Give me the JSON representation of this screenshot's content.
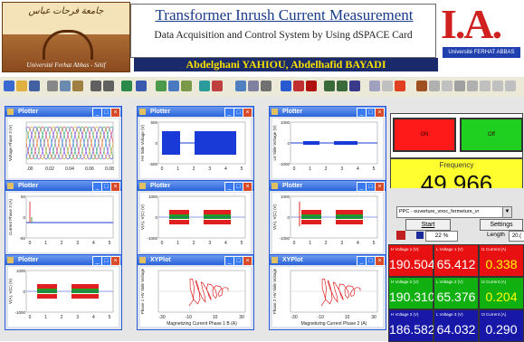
{
  "header": {
    "title": "Transformer Inrush Current Measurement",
    "subtitle": "Data Acquisition and Control System by Using dSPACE Card",
    "authors": "Abdelghani YAHIOU, Abdelhafid BAYADI",
    "left_logo_script": "جامعة فرحات عباس",
    "left_logo_text": "Université Ferhat Abbas - Sétif",
    "right_logo_letters": "I.A.",
    "right_logo_band": "Université FERHAT ABBAS"
  },
  "plots": [
    {
      "title": "Plotter",
      "ylabel": "Voltage Phase 3 (V)",
      "yticks": [
        "",
        "",
        ""
      ],
      "xticks": [
        ".00",
        "0.02",
        "0.04",
        "0.06",
        "0.08"
      ]
    },
    {
      "title": "Plotter",
      "ylabel": "HV Side Voltage (V)",
      "yticks": [
        "500",
        "0",
        "-500"
      ],
      "xticks": [
        "0",
        "1",
        "2",
        "3",
        "4",
        "5"
      ]
    },
    {
      "title": "Plotter",
      "ylabel": "LV Side Voltage (V)",
      "yticks": [
        "1000",
        "0",
        "-1000"
      ],
      "xticks": [
        "0",
        "1",
        "2",
        "3",
        "4",
        "5"
      ]
    },
    {
      "title": "Plotter",
      "ylabel": "Current Phase 3 (A)",
      "yticks": [
        "50",
        "0",
        "-50"
      ],
      "xticks": [
        "0",
        "1",
        "2",
        "3",
        "4",
        "5"
      ]
    },
    {
      "title": "Plotter",
      "ylabel": "V(A), V(C) (V)",
      "yticks": [
        "1000",
        "0",
        "-1000"
      ],
      "xticks": [
        "0",
        "1",
        "2",
        "3",
        "4",
        "5"
      ]
    },
    {
      "title": "Plotter",
      "ylabel": "V(A), V(C) (V)",
      "yticks": [
        "1000",
        "0",
        "-1000"
      ],
      "xticks": [
        "0",
        "1",
        "2",
        "3",
        "4",
        "5"
      ]
    },
    {
      "title": "Plotter",
      "ylabel": "V(A), V(C) (V)",
      "yticks": [
        "1000",
        "0",
        "-1000"
      ],
      "xticks": [
        "0",
        "1",
        "2",
        "3",
        "4",
        "5"
      ]
    },
    {
      "title": "XYPlot",
      "ylabel": "Phase 1 HV Side Voltage",
      "xlabel": "Magnetizing Current Phase 1 B (A)",
      "yticks": [
        "",
        ""
      ],
      "xticks": [
        "-30",
        "-10",
        "10",
        "30"
      ]
    },
    {
      "title": "XYPlot",
      "ylabel": "Phase 2 HV Side Voltage",
      "xlabel": "Magnetizing Current Phase 2 (A)",
      "yticks": [
        "",
        ""
      ],
      "xticks": [
        "-30",
        "-10",
        "10",
        "30"
      ]
    }
  ],
  "right_panel": {
    "btn1_label": "ON",
    "btn2_label": "Off",
    "frequency_label": "Frequency",
    "frequency_value": "49.966",
    "ppc_select": "PPC - ouverture_vnoc_fermeture_vr",
    "start_label": "Start",
    "settings_label": "Settings",
    "progress": "22 %",
    "length_label": "Length",
    "length_value": "20.(",
    "meters": [
      {
        "label": "H Voltage 1 (V)",
        "value": "190.504",
        "color": "red"
      },
      {
        "label": "L Voltage 1 (V)",
        "value": "65.412",
        "color": "red"
      },
      {
        "label": "I1 Current (A)",
        "value": "0.338",
        "color": "red",
        "yellow": true
      },
      {
        "label": "H Voltage 2 (V)",
        "value": "190.310",
        "color": "green"
      },
      {
        "label": "L Voltage 2 (V)",
        "value": "65.376",
        "color": "green"
      },
      {
        "label": "I2 Current (A)",
        "value": "0.204",
        "color": "green",
        "yellow": true
      },
      {
        "label": "H Voltage 3 (V)",
        "value": "186.582",
        "color": "blue"
      },
      {
        "label": "L Voltage 3 (V)",
        "value": "64.032",
        "color": "blue"
      },
      {
        "label": "I3 Current (A)",
        "value": "0.290",
        "color": "blue"
      }
    ]
  }
}
